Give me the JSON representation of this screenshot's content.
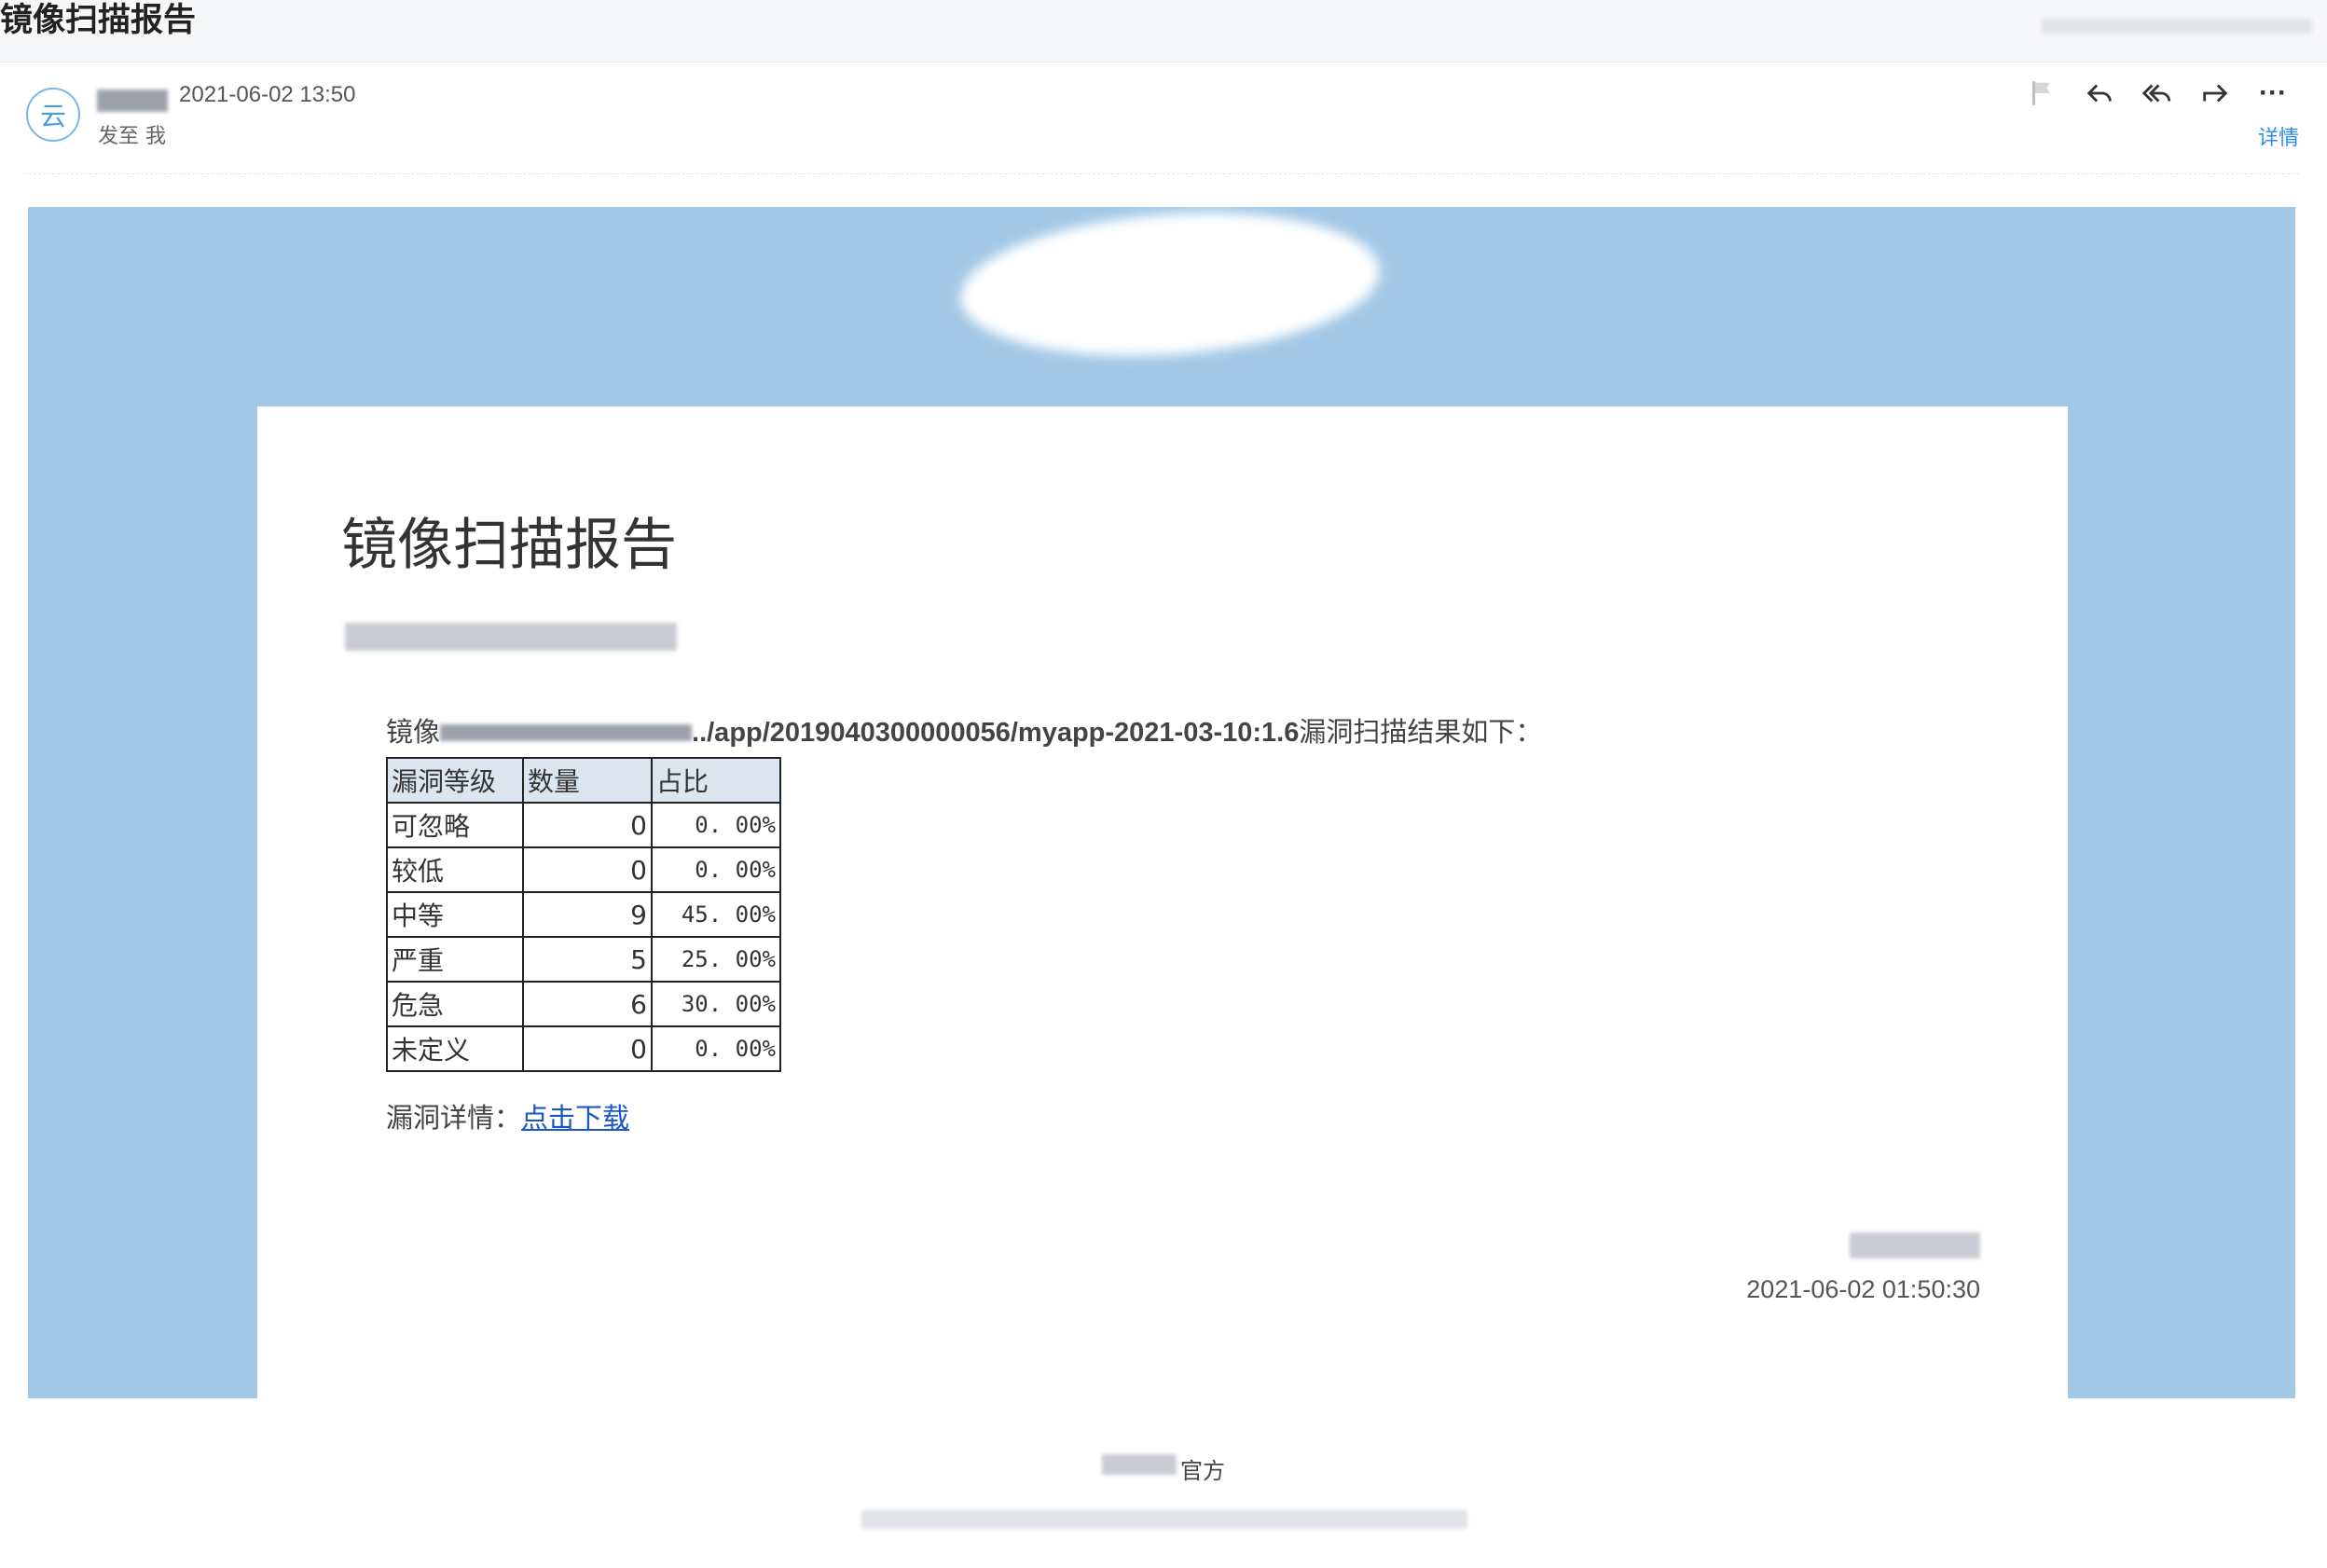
{
  "header": {
    "subject": "镜像扫描报告"
  },
  "message": {
    "avatar_char": "云",
    "sent_time": "2021-06-02 13:50",
    "to_label": "发至 我",
    "details_link": "详情"
  },
  "toolbar": {
    "icons": [
      "flag-icon",
      "reply-icon",
      "reply-all-icon",
      "forward-icon",
      "more-icon"
    ],
    "more_glyph": "···"
  },
  "report": {
    "title": "镜像扫描报告",
    "intro_prefix": "镜像",
    "intro_path": "../app/2019040300000056/myapp-2021-03-10:1.6",
    "intro_suffix": "漏洞扫描结果如下：",
    "table": {
      "headers": [
        "漏洞等级",
        "数量",
        "占比"
      ],
      "rows": [
        {
          "level": "可忽略",
          "count": "0",
          "ratio": "0. 00%"
        },
        {
          "level": "较低",
          "count": "0",
          "ratio": "0. 00%"
        },
        {
          "level": "中等",
          "count": "9",
          "ratio": "45. 00%"
        },
        {
          "level": "严重",
          "count": "5",
          "ratio": "25. 00%"
        },
        {
          "level": "危急",
          "count": "6",
          "ratio": "30. 00%"
        },
        {
          "level": "未定义",
          "count": "0",
          "ratio": "0. 00%"
        }
      ]
    },
    "detail_label": "漏洞详情：",
    "download_link": "点击下载",
    "footer_time": "2021-06-02 01:50:30"
  },
  "footer": {
    "line1_suffix": "官方"
  },
  "colors": {
    "banner": "#a3c8e6",
    "link": "#1a56c8",
    "accent": "#2d8cf0",
    "table_header": "#dce6f1"
  }
}
